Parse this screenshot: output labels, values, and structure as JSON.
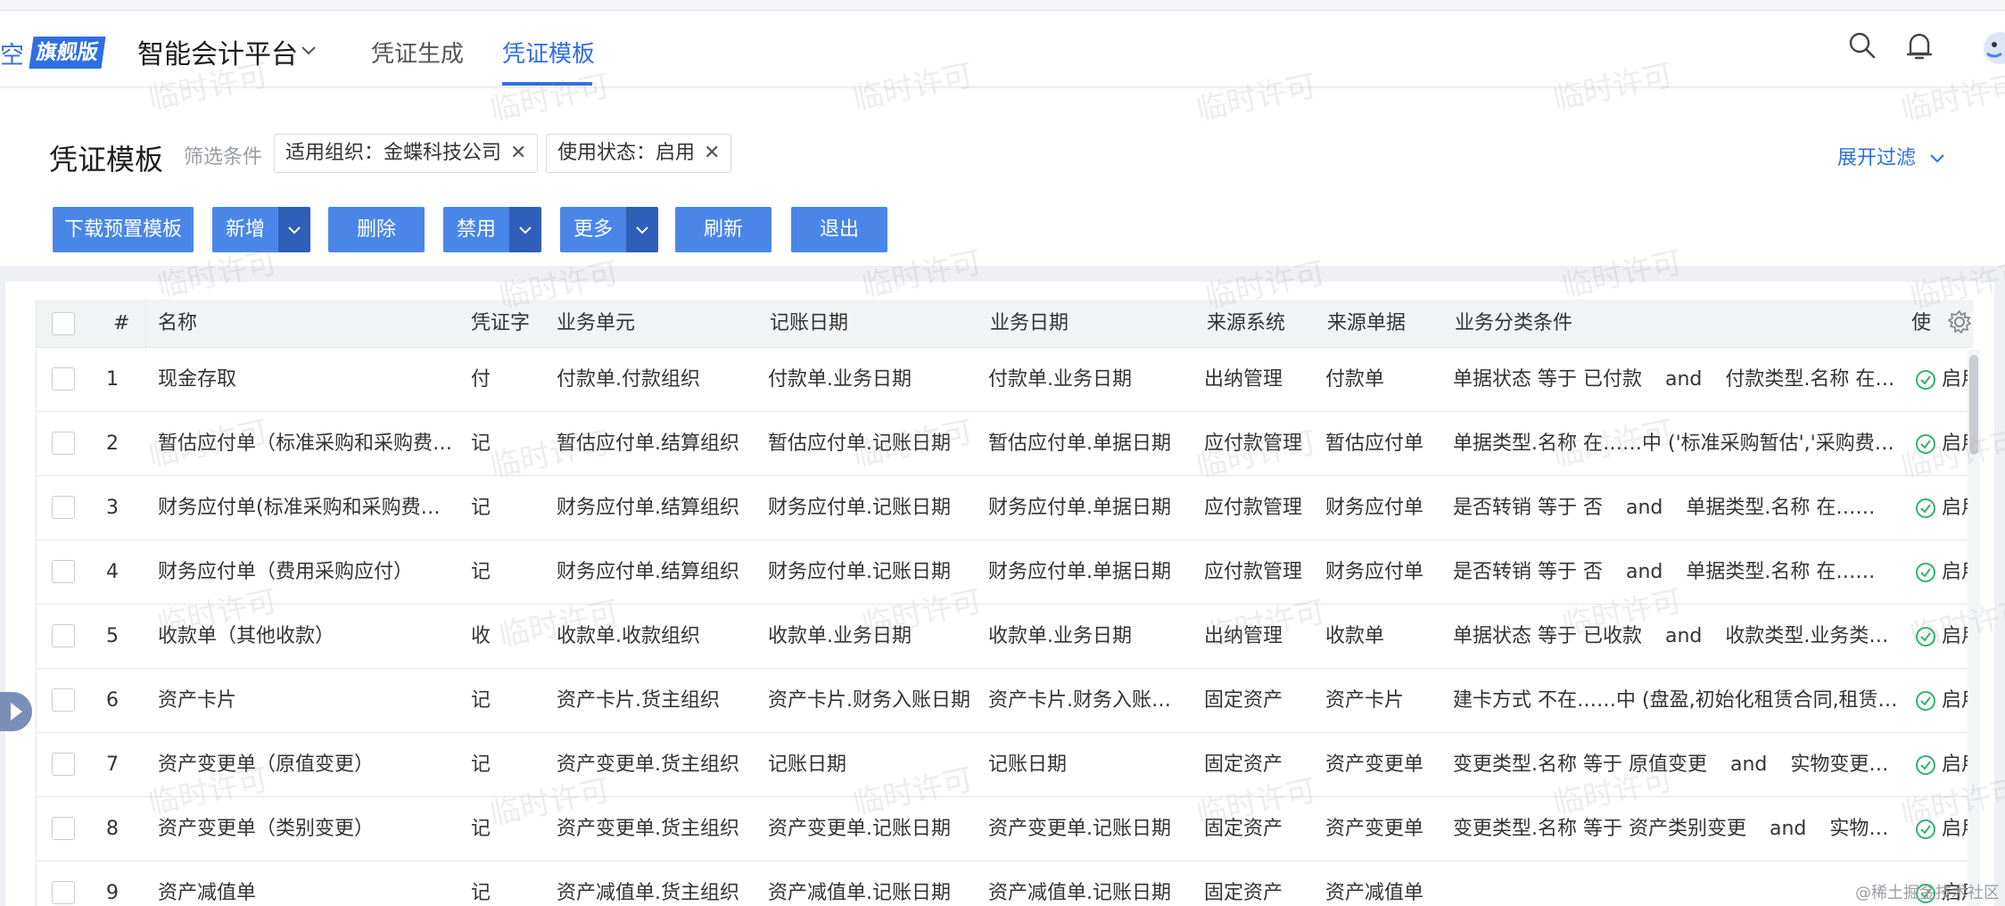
{
  "header": {
    "brand_fragment": "空",
    "brand_badge": "旗舰版",
    "app_title": "智能会计平台",
    "nav_tabs": [
      {
        "label": "凭证生成",
        "active": false
      },
      {
        "label": "凭证模板",
        "active": true
      }
    ],
    "icons": [
      "search-icon",
      "bell-icon",
      "avatar"
    ]
  },
  "page": {
    "title": "凭证模板",
    "filter_label": "筛选条件",
    "filters": [
      {
        "label": "适用组织：金蝶科技公司"
      },
      {
        "label": "使用状态：启用"
      }
    ],
    "expand_filter": "展开过滤"
  },
  "toolbar": {
    "download": "下载预置模板",
    "add": "新增",
    "delete": "删除",
    "disable": "禁用",
    "more": "更多",
    "refresh": "刷新",
    "exit": "退出"
  },
  "table": {
    "columns": [
      "#",
      "名称",
      "凭证字",
      "业务单元",
      "记账日期",
      "业务日期",
      "来源系统",
      "来源单据",
      "业务分类条件",
      "使"
    ],
    "rows": [
      {
        "n": "1",
        "name": "现金存取",
        "word": "付",
        "unit": "付款单.付款组织",
        "acc_date": "付款单.业务日期",
        "biz_date": "付款单.业务日期",
        "sys": "出纳管理",
        "doc": "付款单",
        "cond_a": "单据状态 等于 已付款",
        "cond_and": "and",
        "cond_b": "付款类型.名称 在…",
        "status": "启用"
      },
      {
        "n": "2",
        "name": "暂估应付单（标准采购和采购费…",
        "word": "记",
        "unit": "暂估应付单.结算组织",
        "acc_date": "暂估应付单.记账日期",
        "biz_date": "暂估应付单.单据日期",
        "sys": "应付款管理",
        "doc": "暂估应付单",
        "cond_a": "单据类型.名称 在……中 ('标准采购暂估','采购费…",
        "cond_and": "",
        "cond_b": "",
        "status": "启用"
      },
      {
        "n": "3",
        "name": "财务应付单(标准采购和采购费…",
        "word": "记",
        "unit": "财务应付单.结算组织",
        "acc_date": "财务应付单.记账日期",
        "biz_date": "财务应付单.单据日期",
        "sys": "应付款管理",
        "doc": "财务应付单",
        "cond_a": "是否转销 等于 否",
        "cond_and": "and",
        "cond_b": "单据类型.名称 在……",
        "status": "启用"
      },
      {
        "n": "4",
        "name": "财务应付单（费用采购应付）",
        "word": "记",
        "unit": "财务应付单.结算组织",
        "acc_date": "财务应付单.记账日期",
        "biz_date": "财务应付单.单据日期",
        "sys": "应付款管理",
        "doc": "财务应付单",
        "cond_a": "是否转销 等于 否",
        "cond_and": "and",
        "cond_b": "单据类型.名称 在……",
        "status": "启用"
      },
      {
        "n": "5",
        "name": "收款单（其他收款）",
        "word": "收",
        "unit": "收款单.收款组织",
        "acc_date": "收款单.业务日期",
        "biz_date": "收款单.业务日期",
        "sys": "出纳管理",
        "doc": "收款单",
        "cond_a": "单据状态 等于 已收款",
        "cond_and": "and",
        "cond_b": "收款类型.业务类型…",
        "status": "启用"
      },
      {
        "n": "6",
        "name": "资产卡片",
        "word": "记",
        "unit": "资产卡片.货主组织",
        "acc_date": "资产卡片.财务入账日期",
        "biz_date": "资产卡片.财务入账…",
        "sys": "固定资产",
        "doc": "资产卡片",
        "cond_a": "建卡方式 不在……中 (盘盈,初始化租赁合同,租赁…",
        "cond_and": "",
        "cond_b": "",
        "status": "启用"
      },
      {
        "n": "7",
        "name": "资产变更单（原值变更）",
        "word": "记",
        "unit": "资产变更单.货主组织",
        "acc_date": "记账日期",
        "biz_date": "记账日期",
        "sys": "固定资产",
        "doc": "资产变更单",
        "cond_a": "变更类型.名称 等于 原值变更",
        "cond_and": "and",
        "cond_b": "实物变更详…",
        "status": "启用"
      },
      {
        "n": "8",
        "name": "资产变更单（类别变更）",
        "word": "记",
        "unit": "资产变更单.货主组织",
        "acc_date": "资产变更单.记账日期",
        "biz_date": "资产变更单.记账日期",
        "sys": "固定资产",
        "doc": "资产变更单",
        "cond_a": "变更类型.名称 等于 资产类别变更",
        "cond_and": "and",
        "cond_b": "实物变…",
        "status": "启用"
      },
      {
        "n": "9",
        "name": "资产减值单",
        "word": "记",
        "unit": "资产减值单.货主组织",
        "acc_date": "资产减值单.记账日期",
        "biz_date": "资产减值单.记账日期",
        "sys": "固定资产",
        "doc": "资产减值单",
        "cond_a": "",
        "cond_and": "",
        "cond_b": "",
        "status": "启用"
      }
    ]
  },
  "watermark": "临时许可",
  "credit": "@稀土掘金技术社区",
  "colors": {
    "accent": "#2f6fe0",
    "button": "#4a86e8",
    "status_ok": "#2fb36b"
  }
}
